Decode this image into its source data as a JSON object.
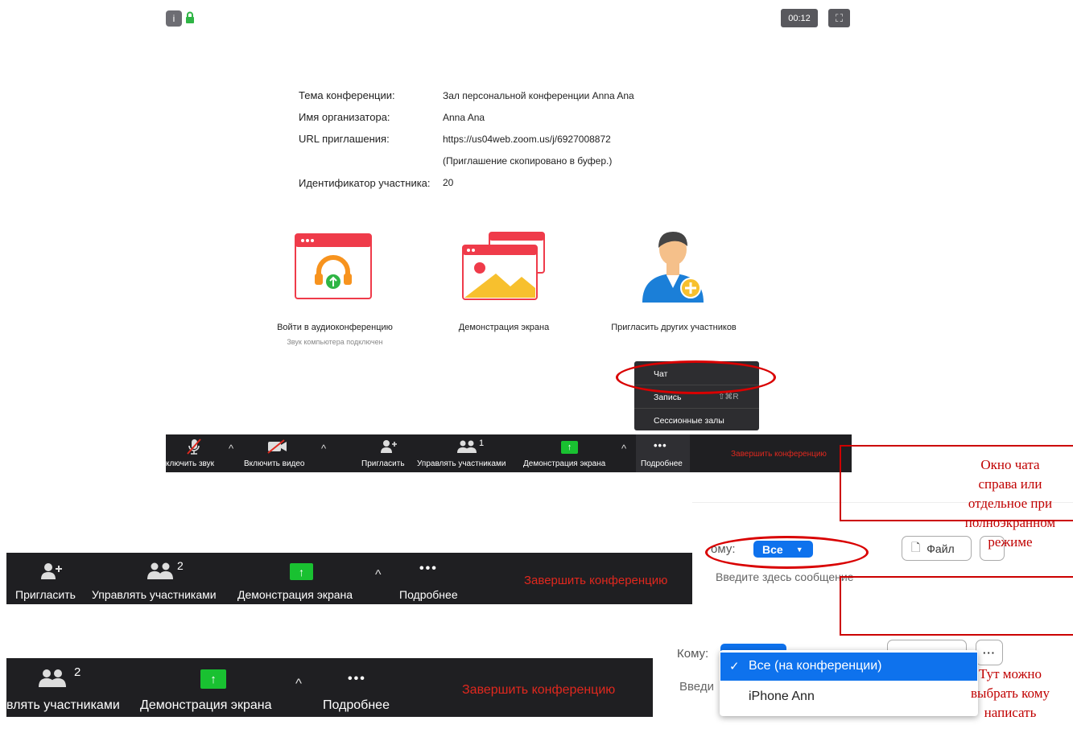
{
  "top_bar": {
    "info_icon": "info-icon",
    "lock_icon": "lock-icon",
    "timer": "00:12",
    "fullscreen_icon": "fullscreen-icon"
  },
  "meeting_info": {
    "topic_label": "Тема конференции:",
    "topic_value": "Зал персональной конференции Anna Ana",
    "host_label": "Имя организатора:",
    "host_value": "Anna Ana",
    "url_label": "URL приглашения:",
    "url_value": "https://us04web.zoom.us/j/6927008872",
    "url_note": "(Приглашение скопировано в буфер.)",
    "participant_id_label": "Идентификатор участника:",
    "participant_id_value": "20"
  },
  "tiles": [
    {
      "label": "Войти в аудиоконференцию",
      "sub": "Звук компьютера подключен",
      "icon": "headphones-icon"
    },
    {
      "label": "Демонстрация экрана",
      "icon": "share-screen-icon"
    },
    {
      "label": "Пригласить других участников",
      "icon": "invite-person-icon"
    }
  ],
  "more_menu": {
    "chat": "Чат",
    "record": "Запись",
    "record_shortcut": "⇧⌘R",
    "breakout": "Сессионные залы"
  },
  "toolbar_main": {
    "mute": "ключить звук",
    "video": "Включить видео",
    "invite": "Пригласить",
    "manage": "Управлять участниками",
    "manage_count": "1",
    "share": "Демонстрация экрана",
    "more": "Подробнее",
    "end": "Завершить конференцию"
  },
  "toolbar_second": {
    "invite": "Пригласить",
    "manage": "Управлять участниками",
    "manage_count": "2",
    "share": "Демонстрация экрана",
    "more": "Подробнее",
    "end": "Завершить конференцию"
  },
  "toolbar_third": {
    "manage": "влять участниками",
    "manage_count": "2",
    "share": "Демонстрация экрана",
    "more": "Подробнее",
    "end": "Завершить конференцию"
  },
  "chat_panel": {
    "to_label": "Кому:",
    "to_label_partial": "ому:",
    "to_value": "Все",
    "file_button": "Файл",
    "input_placeholder": "Введите здесь сообщение",
    "input_placeholder_partial": "Введи"
  },
  "recipient_dropdown": {
    "options": [
      "Все (на конференции)",
      "iPhone Ann"
    ],
    "selected_index": 0
  },
  "annotations": {
    "chat_window": "Окно чата справа или отдельное при полноэкранном режиме",
    "choose_recipient": "Тут можно выбрать кому написать"
  },
  "colors": {
    "toolbar_bg": "#1f1f22",
    "end_red": "#e0281e",
    "share_green": "#19c131",
    "zoom_blue": "#0e72ed",
    "annotation_red": "#c00000"
  }
}
